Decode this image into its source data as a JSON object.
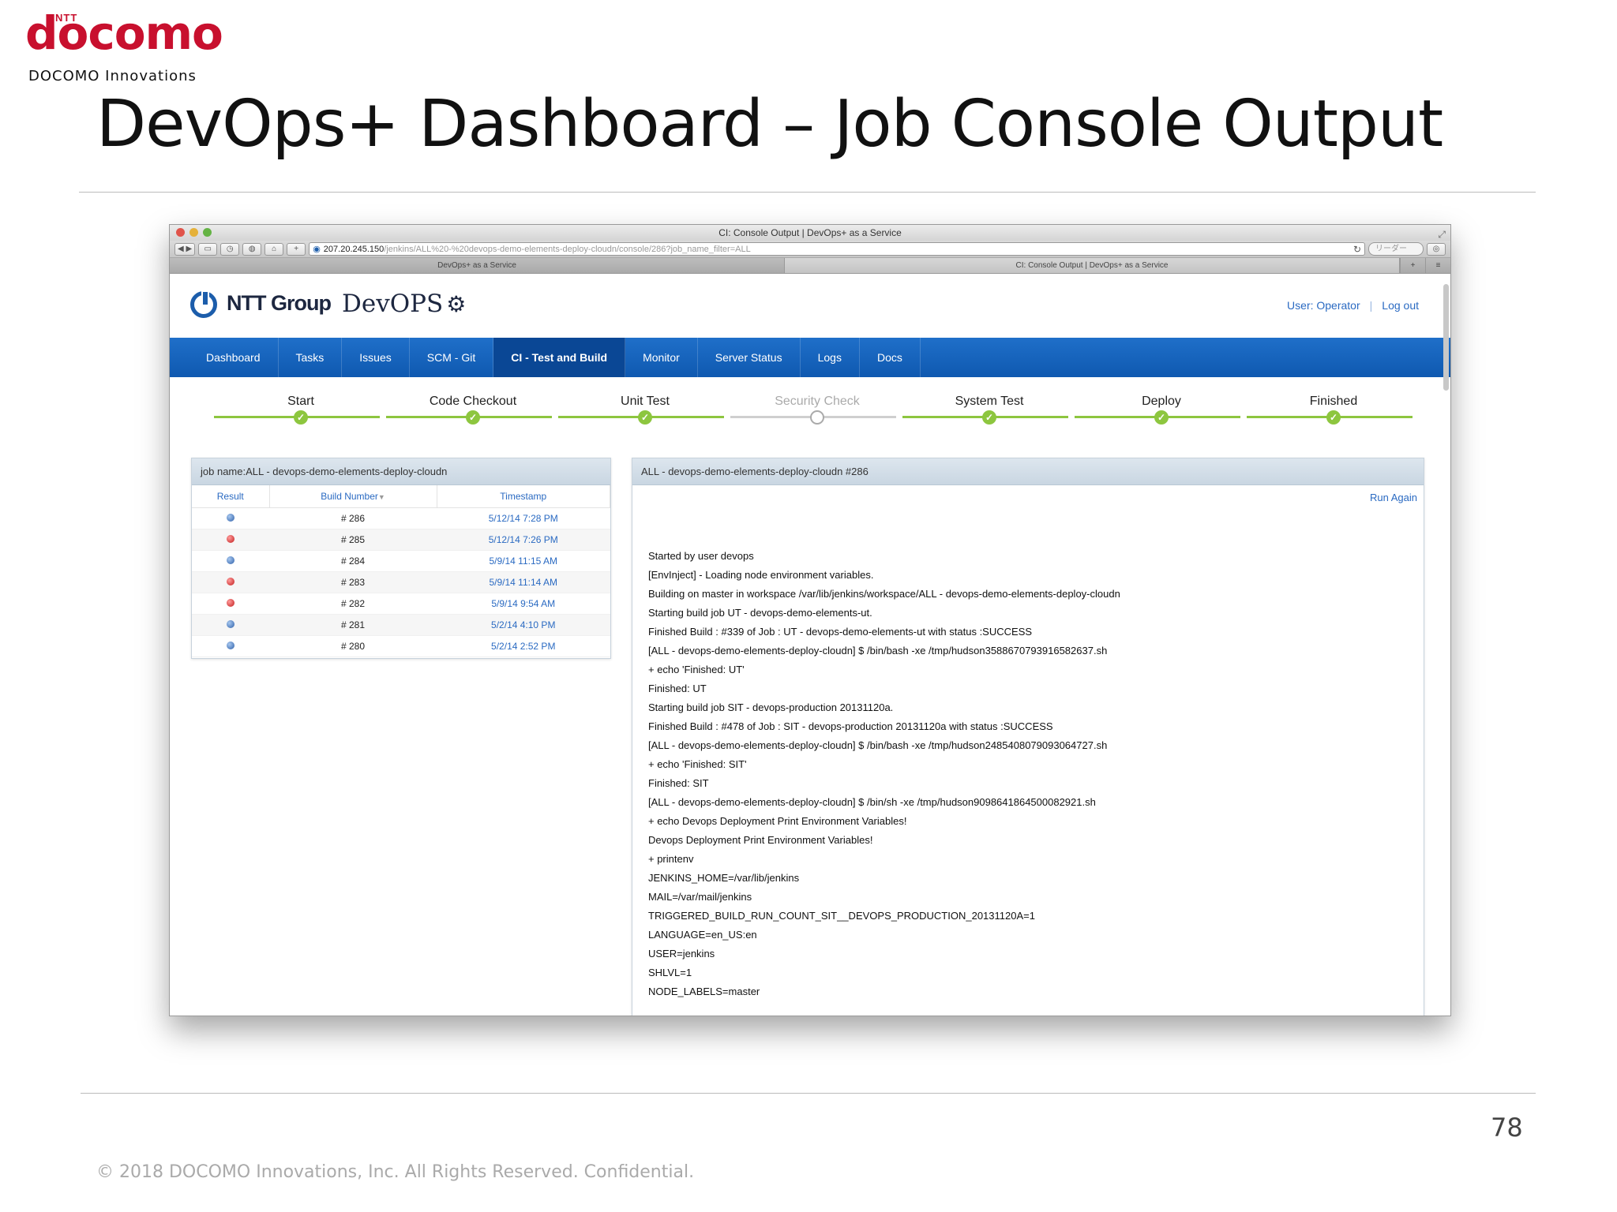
{
  "slide": {
    "logo_ntt": "NTT",
    "logo_docomo": "docomo",
    "logo_sub": "DOCOMO Innovations",
    "title": "DevOps+ Dashboard – Job Console Output",
    "page_number": "78",
    "copyright": "© 2018 DOCOMO Innovations, Inc. All Rights Reserved. Confidential."
  },
  "browser": {
    "window_title": "CI: Console Output | DevOps+ as a Service",
    "url_host": "207.20.245.150",
    "url_path": "/jenkins/ALL%20-%20devops-demo-elements-deploy-cloudn/console/286?job_name_filter=ALL",
    "search_placeholder": "リーダー",
    "tabs": [
      "DevOps+ as a Service",
      "CI: Console Output | DevOps+ as a Service"
    ],
    "new_tab": "+"
  },
  "app": {
    "brand_group": "NTT Group",
    "brand_product": "DevOPS",
    "user_label": "User: Operator",
    "logout_label": "Log out",
    "nav": [
      "Dashboard",
      "Tasks",
      "Issues",
      "SCM - Git",
      "CI - Test and Build",
      "Monitor",
      "Server Status",
      "Logs",
      "Docs"
    ],
    "nav_active": "CI - Test and Build",
    "stages": [
      {
        "label": "Start",
        "status": "done"
      },
      {
        "label": "Code Checkout",
        "status": "done"
      },
      {
        "label": "Unit Test",
        "status": "done"
      },
      {
        "label": "Security Check",
        "status": "pending"
      },
      {
        "label": "System Test",
        "status": "done"
      },
      {
        "label": "Deploy",
        "status": "done"
      },
      {
        "label": "Finished",
        "status": "done"
      }
    ],
    "builds_panel": {
      "title": "job name:ALL - devops-demo-elements-deploy-cloudn",
      "columns": [
        "Result",
        "Build Number",
        "Timestamp"
      ],
      "rows": [
        {
          "result": "blue",
          "build": "# 286",
          "timestamp": "5/12/14 7:28 PM"
        },
        {
          "result": "red",
          "build": "# 285",
          "timestamp": "5/12/14 7:26 PM"
        },
        {
          "result": "blue",
          "build": "# 284",
          "timestamp": "5/9/14 11:15 AM"
        },
        {
          "result": "red",
          "build": "# 283",
          "timestamp": "5/9/14 11:14 AM"
        },
        {
          "result": "red",
          "build": "# 282",
          "timestamp": "5/9/14 9:54 AM"
        },
        {
          "result": "blue",
          "build": "# 281",
          "timestamp": "5/2/14 4:10 PM"
        },
        {
          "result": "blue",
          "build": "# 280",
          "timestamp": "5/2/14 2:52 PM"
        }
      ]
    },
    "console_panel": {
      "title": "ALL - devops-demo-elements-deploy-cloudn #286",
      "run_again": "Run Again",
      "lines": [
        "Started by user devops",
        "[EnvInject] - Loading node environment variables.",
        "Building on master in workspace /var/lib/jenkins/workspace/ALL - devops-demo-elements-deploy-cloudn",
        "Starting build job UT - devops-demo-elements-ut.",
        "Finished Build : #339 of Job : UT - devops-demo-elements-ut with status :SUCCESS",
        "[ALL - devops-demo-elements-deploy-cloudn] $ /bin/bash -xe /tmp/hudson3588670793916582637.sh",
        "+ echo 'Finished: UT'",
        "Finished: UT",
        "Starting build job SIT - devops-production 20131120a.",
        "Finished Build : #478 of Job : SIT - devops-production 20131120a with status :SUCCESS",
        "[ALL - devops-demo-elements-deploy-cloudn] $ /bin/bash -xe /tmp/hudson2485408079093064727.sh",
        "+ echo 'Finished: SIT'",
        "Finished: SIT",
        "[ALL - devops-demo-elements-deploy-cloudn] $ /bin/sh -xe /tmp/hudson9098641864500082921.sh",
        "+ echo Devops Deployment Print Environment Variables!",
        "Devops Deployment Print Environment Variables!",
        "+ printenv",
        "JENKINS_HOME=/var/lib/jenkins",
        "MAIL=/var/mail/jenkins",
        "TRIGGERED_BUILD_RUN_COUNT_SIT__DEVOPS_PRODUCTION_20131120A=1",
        "LANGUAGE=en_US:en",
        "USER=jenkins",
        "SHLVL=1",
        "NODE_LABELS=master"
      ]
    }
  }
}
